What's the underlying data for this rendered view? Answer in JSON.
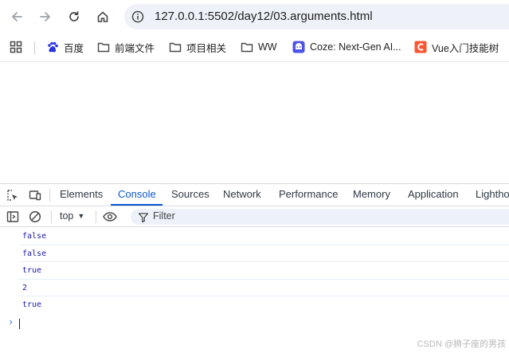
{
  "browser": {
    "url": "127.0.0.1:5502/day12/03.arguments.html",
    "nav_icons": [
      "back-arrow-icon",
      "forward-arrow-icon",
      "reload-icon",
      "home-icon",
      "site-info-icon"
    ]
  },
  "bookmarks": [
    {
      "label": "百度",
      "icon": "baidu-paw-icon"
    },
    {
      "label": "前端文件",
      "icon": "folder-icon"
    },
    {
      "label": "项目相关",
      "icon": "folder-icon"
    },
    {
      "label": "WW",
      "icon": "folder-icon"
    },
    {
      "label": "Coze: Next-Gen AI...",
      "icon": "coze-icon"
    },
    {
      "label": "Vue入门技能树",
      "icon": "csdn-icon"
    }
  ],
  "devtools": {
    "tabs": [
      "Elements",
      "Console",
      "Sources",
      "Network",
      "Performance",
      "Memory",
      "Application",
      "Lighthouse"
    ],
    "active_tab": "Console",
    "context": "top",
    "filter_placeholder": "Filter",
    "accent_color": "#0b57d0",
    "log_color": "#1a1aa6",
    "logs": [
      "false",
      "false",
      "true",
      "2",
      "true"
    ]
  },
  "watermark": "CSDN @狮子座的男孩"
}
